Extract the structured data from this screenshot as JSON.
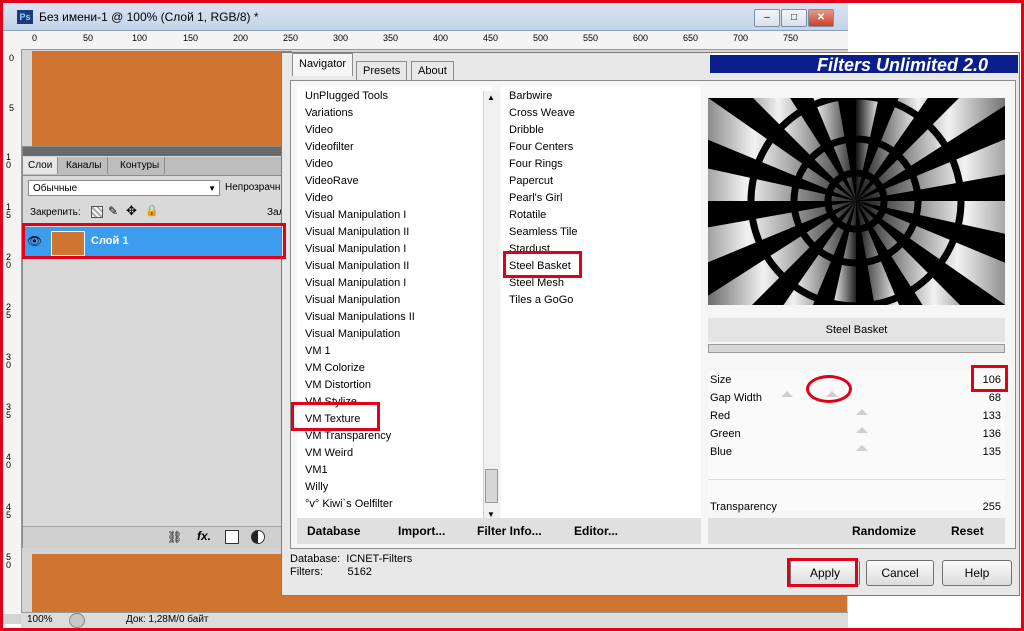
{
  "colors": {
    "accent_red": "#e0001a",
    "canvas_orange": "#d07531",
    "banner_blue": "#0a1e8c",
    "selection_blue": "#3c9cf0"
  },
  "ps": {
    "title": "Без имени-1 @ 100% (Слой 1, RGB/8) *",
    "logo": "Ps",
    "ruler_top": [
      "0",
      "50",
      "100",
      "150",
      "200",
      "250",
      "300",
      "350",
      "400",
      "450",
      "500",
      "550",
      "600",
      "650",
      "700",
      "750"
    ],
    "ruler_left": [
      "0",
      "5",
      "1 0",
      "1 5",
      "2 0",
      "2 5",
      "3 0",
      "3 5",
      "4 0",
      "4 5",
      "5 0"
    ],
    "status": {
      "zoom": "100%",
      "doc": "Док: 1,28M/0 байт"
    },
    "window_buttons": {
      "minimize": "–",
      "maximize": "□",
      "close": "✕"
    }
  },
  "layers": {
    "tabs": [
      "Слои",
      "Каналы",
      "Контуры"
    ],
    "blend_mode": "Обычные",
    "opacity_label": "Непрозрачн",
    "lock_label": "Закрепить:",
    "fill_label": "Зал",
    "layer_name": "Слой 1",
    "bottom_icons": [
      "link-icon",
      "fx-icon",
      "mask-icon",
      "adjustment-icon"
    ],
    "fx_text": "fx."
  },
  "fu": {
    "banner": "Filters Unlimited 2.0",
    "tabs": [
      "Navigator",
      "Presets",
      "About"
    ],
    "categories": [
      "UnPlugged Tools",
      "Variations",
      "Video",
      "Videofilter",
      "Video",
      "VideoRave",
      "Video",
      "Visual Manipulation I",
      "Visual Manipulation II",
      "Visual Manipulation I",
      "Visual Manipulation II",
      "Visual Manipulation I",
      "Visual Manipulation",
      "Visual Manipulations II",
      "Visual Manipulation",
      "VM 1",
      "VM Colorize",
      "VM Distortion",
      "VM Stylize",
      "VM Texture",
      "VM Transparency",
      "VM Weird",
      "VM1",
      "Willy",
      "°v° Kiwi`s Oelfilter"
    ],
    "filters": [
      "Barbwire",
      "Cross Weave",
      "Dribble",
      "Four Centers",
      "Four Rings",
      "Papercut",
      "Pearl's Girl",
      "Rotatile",
      "Seamless Tile",
      "Stardust",
      "Steel Basket",
      "Steel Mesh",
      "Tiles a GoGo"
    ],
    "selected_filter": "Steel Basket",
    "params": [
      {
        "name": "Size",
        "value": "106"
      },
      {
        "name": "Gap Width",
        "value": "68"
      },
      {
        "name": "Red",
        "value": "133"
      },
      {
        "name": "Green",
        "value": "136"
      },
      {
        "name": "Blue",
        "value": "135"
      },
      {
        "name": "Transparency",
        "value": "255"
      }
    ],
    "left_actions": [
      "Database",
      "Import...",
      "Filter Info...",
      "Editor..."
    ],
    "right_actions": [
      "Randomize",
      "Reset"
    ],
    "footer": {
      "database_label": "Database:",
      "database_value": "ICNET-Filters",
      "filters_label": "Filters:",
      "filters_value": "5162"
    },
    "buttons": {
      "apply": "Apply",
      "cancel": "Cancel",
      "help": "Help"
    }
  }
}
